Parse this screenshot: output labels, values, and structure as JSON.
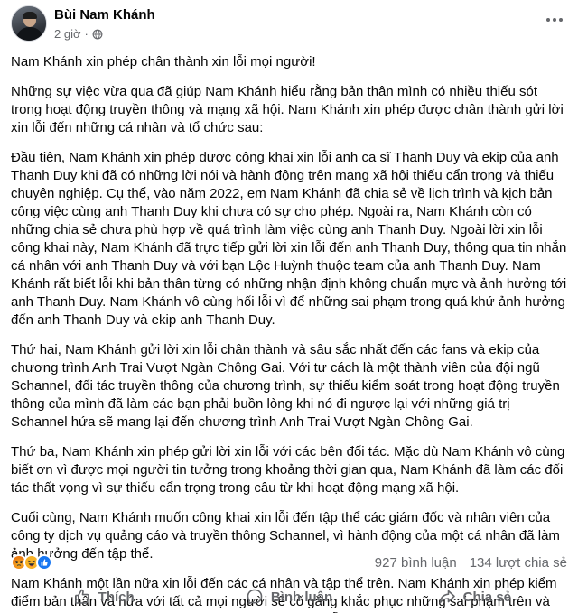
{
  "post": {
    "author": "Bùi Nam Khánh",
    "time": "2 giờ",
    "dot": "·",
    "paragraphs": [
      "Nam Khánh xin phép chân thành xin lỗi mọi người!",
      "Những sự việc vừa qua đã giúp Nam Khánh hiểu rằng bản thân mình có nhiều thiếu sót trong hoạt động truyền thông và mạng xã hội. Nam Khánh xin phép được chân thành gửi lời xin lỗi đến những cá nhân và tổ chức sau:",
      "Đầu tiên, Nam Khánh xin phép được công khai xin lỗi anh ca sĩ Thanh Duy và ekip của anh Thanh Duy khi đã có những lời nói và hành động trên mạng xã hội thiếu cẩn trọng và thiếu chuyên nghiệp. Cụ thể, vào năm 2022, em Nam Khánh đã chia sẻ về lịch trình và kịch bản công việc cùng anh Thanh Duy khi chưa có sự cho phép. Ngoài ra, Nam Khánh còn có những chia sẻ chưa phù hợp về quá trình làm việc cùng anh Thanh Duy. Ngoài lời xin lỗi công khai này, Nam Khánh đã trực tiếp gửi lời xin lỗi đến anh Thanh Duy, thông qua tin nhắn cá nhân với anh Thanh Duy và với bạn Lộc Huỳnh thuộc team của anh Thanh Duy. Nam Khánh rất biết lỗi khi bản thân từng có những nhận định không chuẩn mực và ảnh hưởng tới anh Thanh Duy. Nam Khánh vô cùng hối lỗi vì để những sai phạm trong quá khứ ảnh hưởng đến anh Thanh Duy và ekip anh Thanh Duy.",
      "Thứ hai, Nam Khánh gửi lời xin lỗi chân thành và sâu sắc nhất đến các fans và ekip của chương trình Anh Trai Vượt Ngàn Chông Gai. Với tư cách là một thành viên của đội ngũ Schannel, đối tác truyền thông của chương trình, sự thiếu kiểm soát trong hoạt động truyền thông của mình đã làm các bạn phải buồn lòng khi nó đi ngược lại với những giá trị Schannel hứa sẽ mang lại đến chương trình Anh Trai Vượt Ngàn Chông Gai.",
      "Thứ ba, Nam Khánh xin phép gửi lời xin lỗi với các bên đối tác. Mặc dù Nam Khánh vô cùng biết ơn vì được mọi người tin tưởng trong khoảng thời gian qua, Nam Khánh đã làm các đối tác thất vọng vì sự thiếu cẩn trọng trong câu từ khi hoạt động mạng xã hội.",
      "Cuối cùng, Nam Khánh muốn công khai xin lỗi đến tập thể các giám đốc và nhân viên của công ty dịch vụ quảng cáo và truyền thông Schannel, vì hành động của một cá nhân đã làm ảnh hưởng đến tập thể.",
      "Nam Khánh một lần nữa xin lỗi đến các cá nhân và tập thể trên. Nam Khánh xin phép kiểm điểm bản thân và hứa với tất cả mọi người sẽ cố gắng khắc phục những sai phạm trên và đảm bảo những sai phạm này sẽ không bao giờ tái diễn."
    ]
  },
  "stats": {
    "comments": "927 bình luận",
    "shares": "134 lượt chia sẻ"
  },
  "actions": {
    "like": "Thích",
    "comment": "Bình luận",
    "share": "Chia sẻ"
  },
  "icons": {
    "reactions": [
      "angry-reaction-icon",
      "haha-reaction-icon",
      "like-reaction-icon"
    ],
    "privacy": "globe-icon",
    "menu": "more-options-icon"
  },
  "colors": {
    "text": "#050505",
    "secondary": "#65676b",
    "like_blue": "#1877f2",
    "divider": "#ced0d4"
  }
}
